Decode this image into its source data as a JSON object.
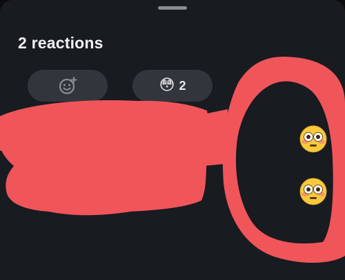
{
  "sheet": {
    "title": "2 reactions"
  },
  "reaction_bar": {
    "add_reaction_icon": "add-emoji-icon",
    "reaction_emoji": "😳",
    "reaction_count": "2"
  },
  "reactions_list": [
    {
      "emoji": "flushed-face"
    },
    {
      "emoji": "flushed-face"
    }
  ],
  "colors": {
    "sheet_background": "#181b20",
    "chip_background": "#32363c",
    "redaction": "#f0555a"
  }
}
